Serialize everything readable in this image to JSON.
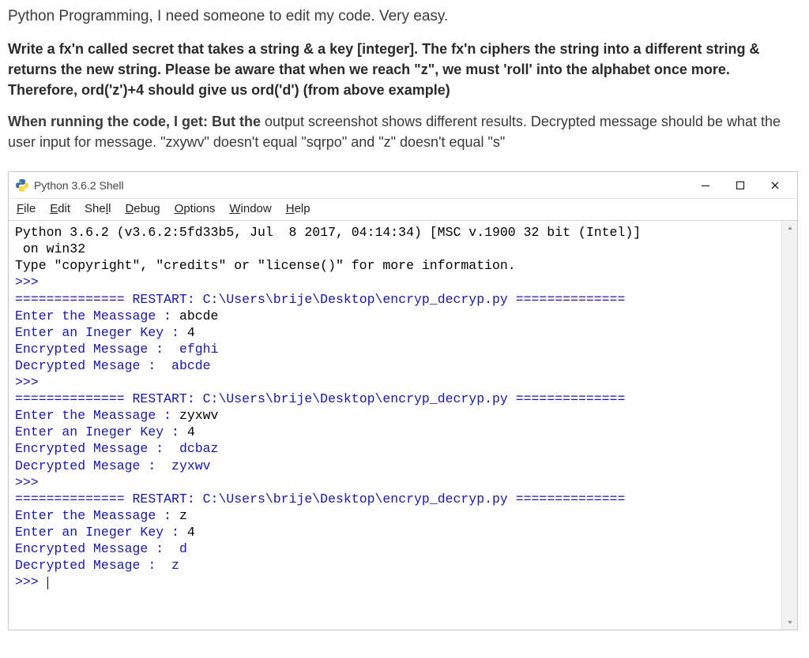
{
  "question": {
    "title": "Python Programming, I need someone to edit my code. Very easy.",
    "bold_para": "Write a fx'n called secret that takes a string & a key [integer]. The fx'n ciphers the string into a different string & returns the new string. Please be aware that when we reach \"z\", we must 'roll' into the alphabet once more. Therefore, ord('z')+4 should give us ord('d') (from above example)",
    "mixed_bold": "When running the code, I get: But the ",
    "mixed_rest": "output screenshot shows different results. Decrypted message should be what the user input for message. \"zxywv\" doesn't equal \"sqrpo\" and \"z\" doesn't equal \"s\""
  },
  "window": {
    "title": "Python 3.6.2 Shell",
    "menus": {
      "file": "File",
      "edit": "Edit",
      "shell": "Shell",
      "debug": "Debug",
      "options": "Options",
      "window": "Window",
      "help": "Help"
    }
  },
  "console": {
    "banner1": "Python 3.6.2 (v3.6.2:5fd33b5, Jul  8 2017, 04:14:34) [MSC v.1900 32 bit (Intel)]",
    "banner2": " on win32",
    "banner3": "Type \"copyright\", \"credits\" or \"license()\" for more information.",
    "prompt": ">>>",
    "restart_label": " RESTART: ",
    "restart_path": "C:\\Users\\brije\\Desktop\\encryp_decryp.py",
    "restart_bar_left": "==============",
    "restart_bar_right": " ==============",
    "runs": [
      {
        "msg_prompt": "Enter the Meassage : ",
        "msg_val": "abcde",
        "key_prompt": "Enter an Ineger Key : ",
        "key_val": "4",
        "enc_label": "Encrypted Message :  ",
        "enc_val": "efghi",
        "dec_label": "Decrypted Mesage :  ",
        "dec_val": "abcde"
      },
      {
        "msg_prompt": "Enter the Meassage : ",
        "msg_val": "zyxwv",
        "key_prompt": "Enter an Ineger Key : ",
        "key_val": "4",
        "enc_label": "Encrypted Message :  ",
        "enc_val": "dcbaz",
        "dec_label": "Decrypted Mesage :  ",
        "dec_val": "zyxwv"
      },
      {
        "msg_prompt": "Enter the Meassage : ",
        "msg_val": "z",
        "key_prompt": "Enter an Ineger Key : ",
        "key_val": "4",
        "enc_label": "Encrypted Message :  ",
        "enc_val": "d",
        "dec_label": "Decrypted Mesage :  ",
        "dec_val": "z"
      }
    ]
  }
}
